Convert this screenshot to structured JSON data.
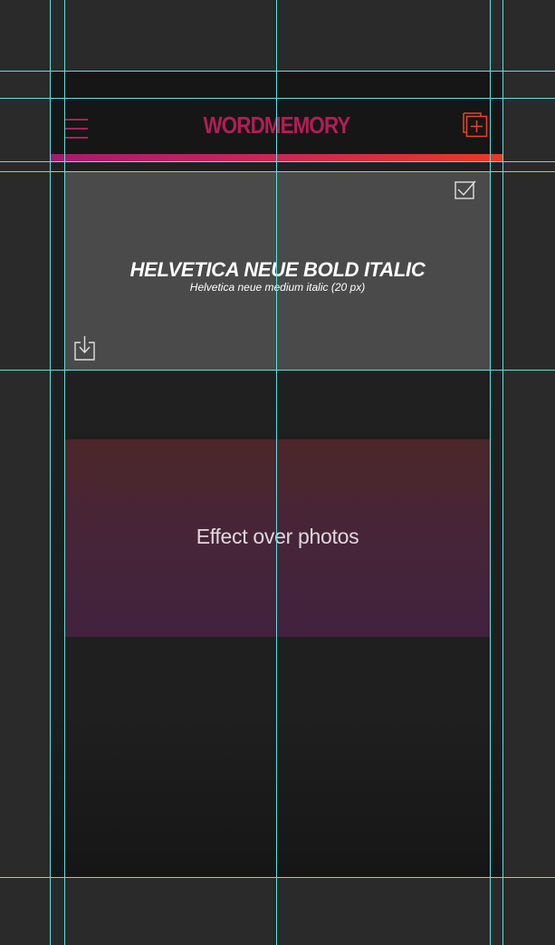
{
  "header": {
    "brand": "WORDMEMORY",
    "menu_icon": "hamburger-menu-icon",
    "add_icon": "add-stack-icon"
  },
  "photo_card": {
    "title": "HELVETICA NEUE BOLD ITALIC",
    "subtitle": "Helvetica neue medium italic  (20 px)",
    "check_icon": "checkbox-checked-icon",
    "download_icon": "download-icon"
  },
  "effect_card": {
    "label": "Effect over photos"
  },
  "colors": {
    "canvas": "#2a2a2a",
    "header_bg": "#161616",
    "brand": "#b01f54",
    "accent_start": "#a01d70",
    "accent_end": "#e83a22",
    "photo_card_bg": "#4a4a4a",
    "effect_top": "#4c2629",
    "effect_bottom": "#41223c",
    "guides": "#5fe0e0"
  }
}
